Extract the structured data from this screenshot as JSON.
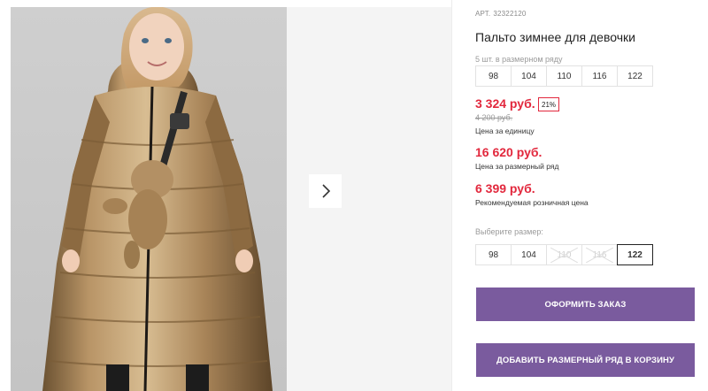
{
  "product": {
    "art_label": "АРТ.",
    "art_number": "32322120",
    "title": "Пальто зимнее для девочки"
  },
  "size_row": {
    "caption": "5 шт. в размерном ряду",
    "sizes": [
      "98",
      "104",
      "110",
      "116",
      "122"
    ]
  },
  "pricing": {
    "unit_price": "3 324 руб.",
    "discount": "21%",
    "old_price": "4 200 руб.",
    "unit_note": "Цена за единицу",
    "row_price": "16 620 руб.",
    "row_note": "Цена за размерный ряд",
    "retail_price": "6 399 руб.",
    "retail_note": "Рекомендуемая розничная цена"
  },
  "size_picker": {
    "caption": "Выберите размер:",
    "sizes": [
      {
        "label": "98",
        "state": "available"
      },
      {
        "label": "104",
        "state": "available"
      },
      {
        "label": "110",
        "state": "unavailable"
      },
      {
        "label": "116",
        "state": "unavailable"
      },
      {
        "label": "122",
        "state": "selected"
      }
    ]
  },
  "actions": {
    "order_label": "ОФОРМИТЬ ЗАКАЗ",
    "add_row_label": "ДОБАВИТЬ РАЗМЕРНЫЙ РЯД В КОРЗИНУ"
  },
  "gallery": {
    "next_icon": "chevron-right-icon"
  },
  "colors": {
    "accent_button": "#7a5b9e",
    "price_red": "#e2283d",
    "coat_gold": "#a9875a"
  }
}
